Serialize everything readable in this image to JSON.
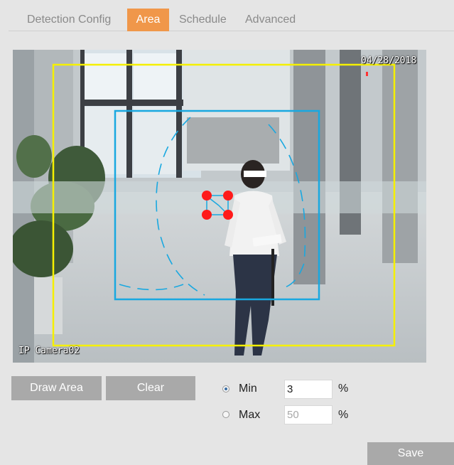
{
  "tabs": [
    {
      "label": "Detection Config",
      "active": false
    },
    {
      "label": "Area",
      "active": true
    },
    {
      "label": "Schedule",
      "active": false
    },
    {
      "label": "Advanced",
      "active": false
    }
  ],
  "video": {
    "date": "04/28/2018",
    "camera_name": "IP Camera02",
    "colors": {
      "outer_box": "#f5f000",
      "inner_box": "#19a8e0",
      "handles": "#ff1a1a"
    }
  },
  "controls": {
    "draw_area_label": "Draw Area",
    "clear_label": "Clear",
    "min_label": "Min",
    "max_label": "Max",
    "min_value": "3",
    "max_value": "50",
    "unit": "%",
    "selected": "min",
    "save_label": "Save"
  },
  "colors": {
    "active_tab": "#f0974a",
    "button": "#a9a9a9",
    "background": "#e5e5e5"
  }
}
